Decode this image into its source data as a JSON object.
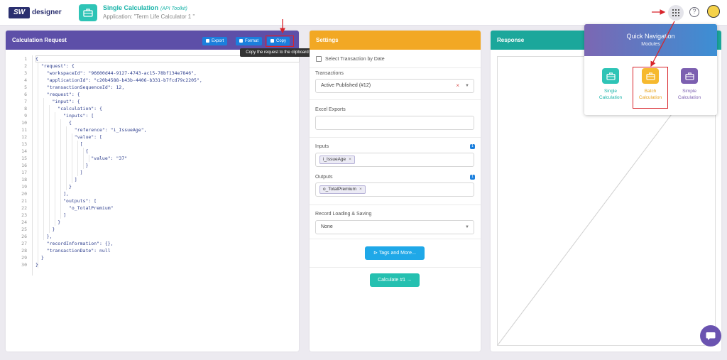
{
  "header": {
    "logo_text": "SW",
    "logo_sub": "designer",
    "title": "Single Calculation",
    "title_tag": "(API Toolkit)",
    "application": "Application: \"Term Life Calculator 1 \"",
    "help_icon": "?"
  },
  "request_panel": {
    "title": "Calculation Request",
    "export_label": "Export",
    "format_label": "Format",
    "copy_label": "Copy",
    "tooltip": "Copy the request to the clipboard",
    "lines": [
      {
        "n": "1",
        "t": "{"
      },
      {
        "n": "2",
        "t": "  \"request\": {"
      },
      {
        "n": "3",
        "t": "    \"workspaceId\": \"96600d44-9127-4743-ac15-78bf134e7846\","
      },
      {
        "n": "4",
        "t": "    \"applicationId\": \"c20b4588-b43b-4406-b331-b7fcd79c2205\","
      },
      {
        "n": "5",
        "t": "    \"transactionSequenceId\": 12,"
      },
      {
        "n": "6",
        "t": "    \"request\": {"
      },
      {
        "n": "7",
        "t": "      \"input\": {"
      },
      {
        "n": "8",
        "t": "        \"calculation\": {"
      },
      {
        "n": "9",
        "t": "          \"inputs\": ["
      },
      {
        "n": "10",
        "t": "            {"
      },
      {
        "n": "11",
        "t": "              \"reference\": \"i_IssueAge\","
      },
      {
        "n": "12",
        "t": "              \"value\": ["
      },
      {
        "n": "13",
        "t": "                ["
      },
      {
        "n": "14",
        "t": "                  {"
      },
      {
        "n": "15",
        "t": "                    \"value\": \"37\""
      },
      {
        "n": "16",
        "t": "                  }"
      },
      {
        "n": "17",
        "t": "                ]"
      },
      {
        "n": "18",
        "t": "              ]"
      },
      {
        "n": "19",
        "t": "            }"
      },
      {
        "n": "20",
        "t": "          ],"
      },
      {
        "n": "21",
        "t": "          \"outputs\": ["
      },
      {
        "n": "22",
        "t": "            \"o_TotalPremium\""
      },
      {
        "n": "23",
        "t": "          ]"
      },
      {
        "n": "24",
        "t": "        }"
      },
      {
        "n": "25",
        "t": "      }"
      },
      {
        "n": "26",
        "t": "    },"
      },
      {
        "n": "27",
        "t": "    \"recordInformation\": {},"
      },
      {
        "n": "28",
        "t": "    \"transactionDate\": null"
      },
      {
        "n": "29",
        "t": "  }"
      },
      {
        "n": "30",
        "t": "}"
      }
    ]
  },
  "settings_panel": {
    "title": "Settings",
    "select_by_date": "Select Transaction by Date",
    "transactions_label": "Transactions",
    "transactions_value": "Active Published (#12)",
    "excel_exports_label": "Excel Exports",
    "inputs_label": "Inputs",
    "inputs_count": "1",
    "inputs_chip": "i_IssueAge",
    "outputs_label": "Outputs",
    "outputs_count": "1",
    "outputs_chip": "o_TotalPremium",
    "record_label": "Record Loading & Saving",
    "record_value": "None",
    "tags_button": "Tags and More...",
    "calculate_button": "Calculate #1 →"
  },
  "response_panel": {
    "title": "Response"
  },
  "quick_nav": {
    "title": "Quick Navigation",
    "subtitle": "Modules",
    "items": [
      {
        "label_1": "Single",
        "label_2": "Calculation",
        "color": "#2ec4b6"
      },
      {
        "label_1": "Batch",
        "label_2": "Calculation",
        "color": "#f6b92e"
      },
      {
        "label_1": "Simple",
        "label_2": "Calculation",
        "color": "#7c5fb0"
      }
    ]
  },
  "colors": {
    "request_header": "#5d4fa8",
    "settings_header": "#f2a824",
    "response_header": "#1ba79b",
    "button_blue": "#1b7fdd",
    "annotation_red": "#d8232a"
  }
}
